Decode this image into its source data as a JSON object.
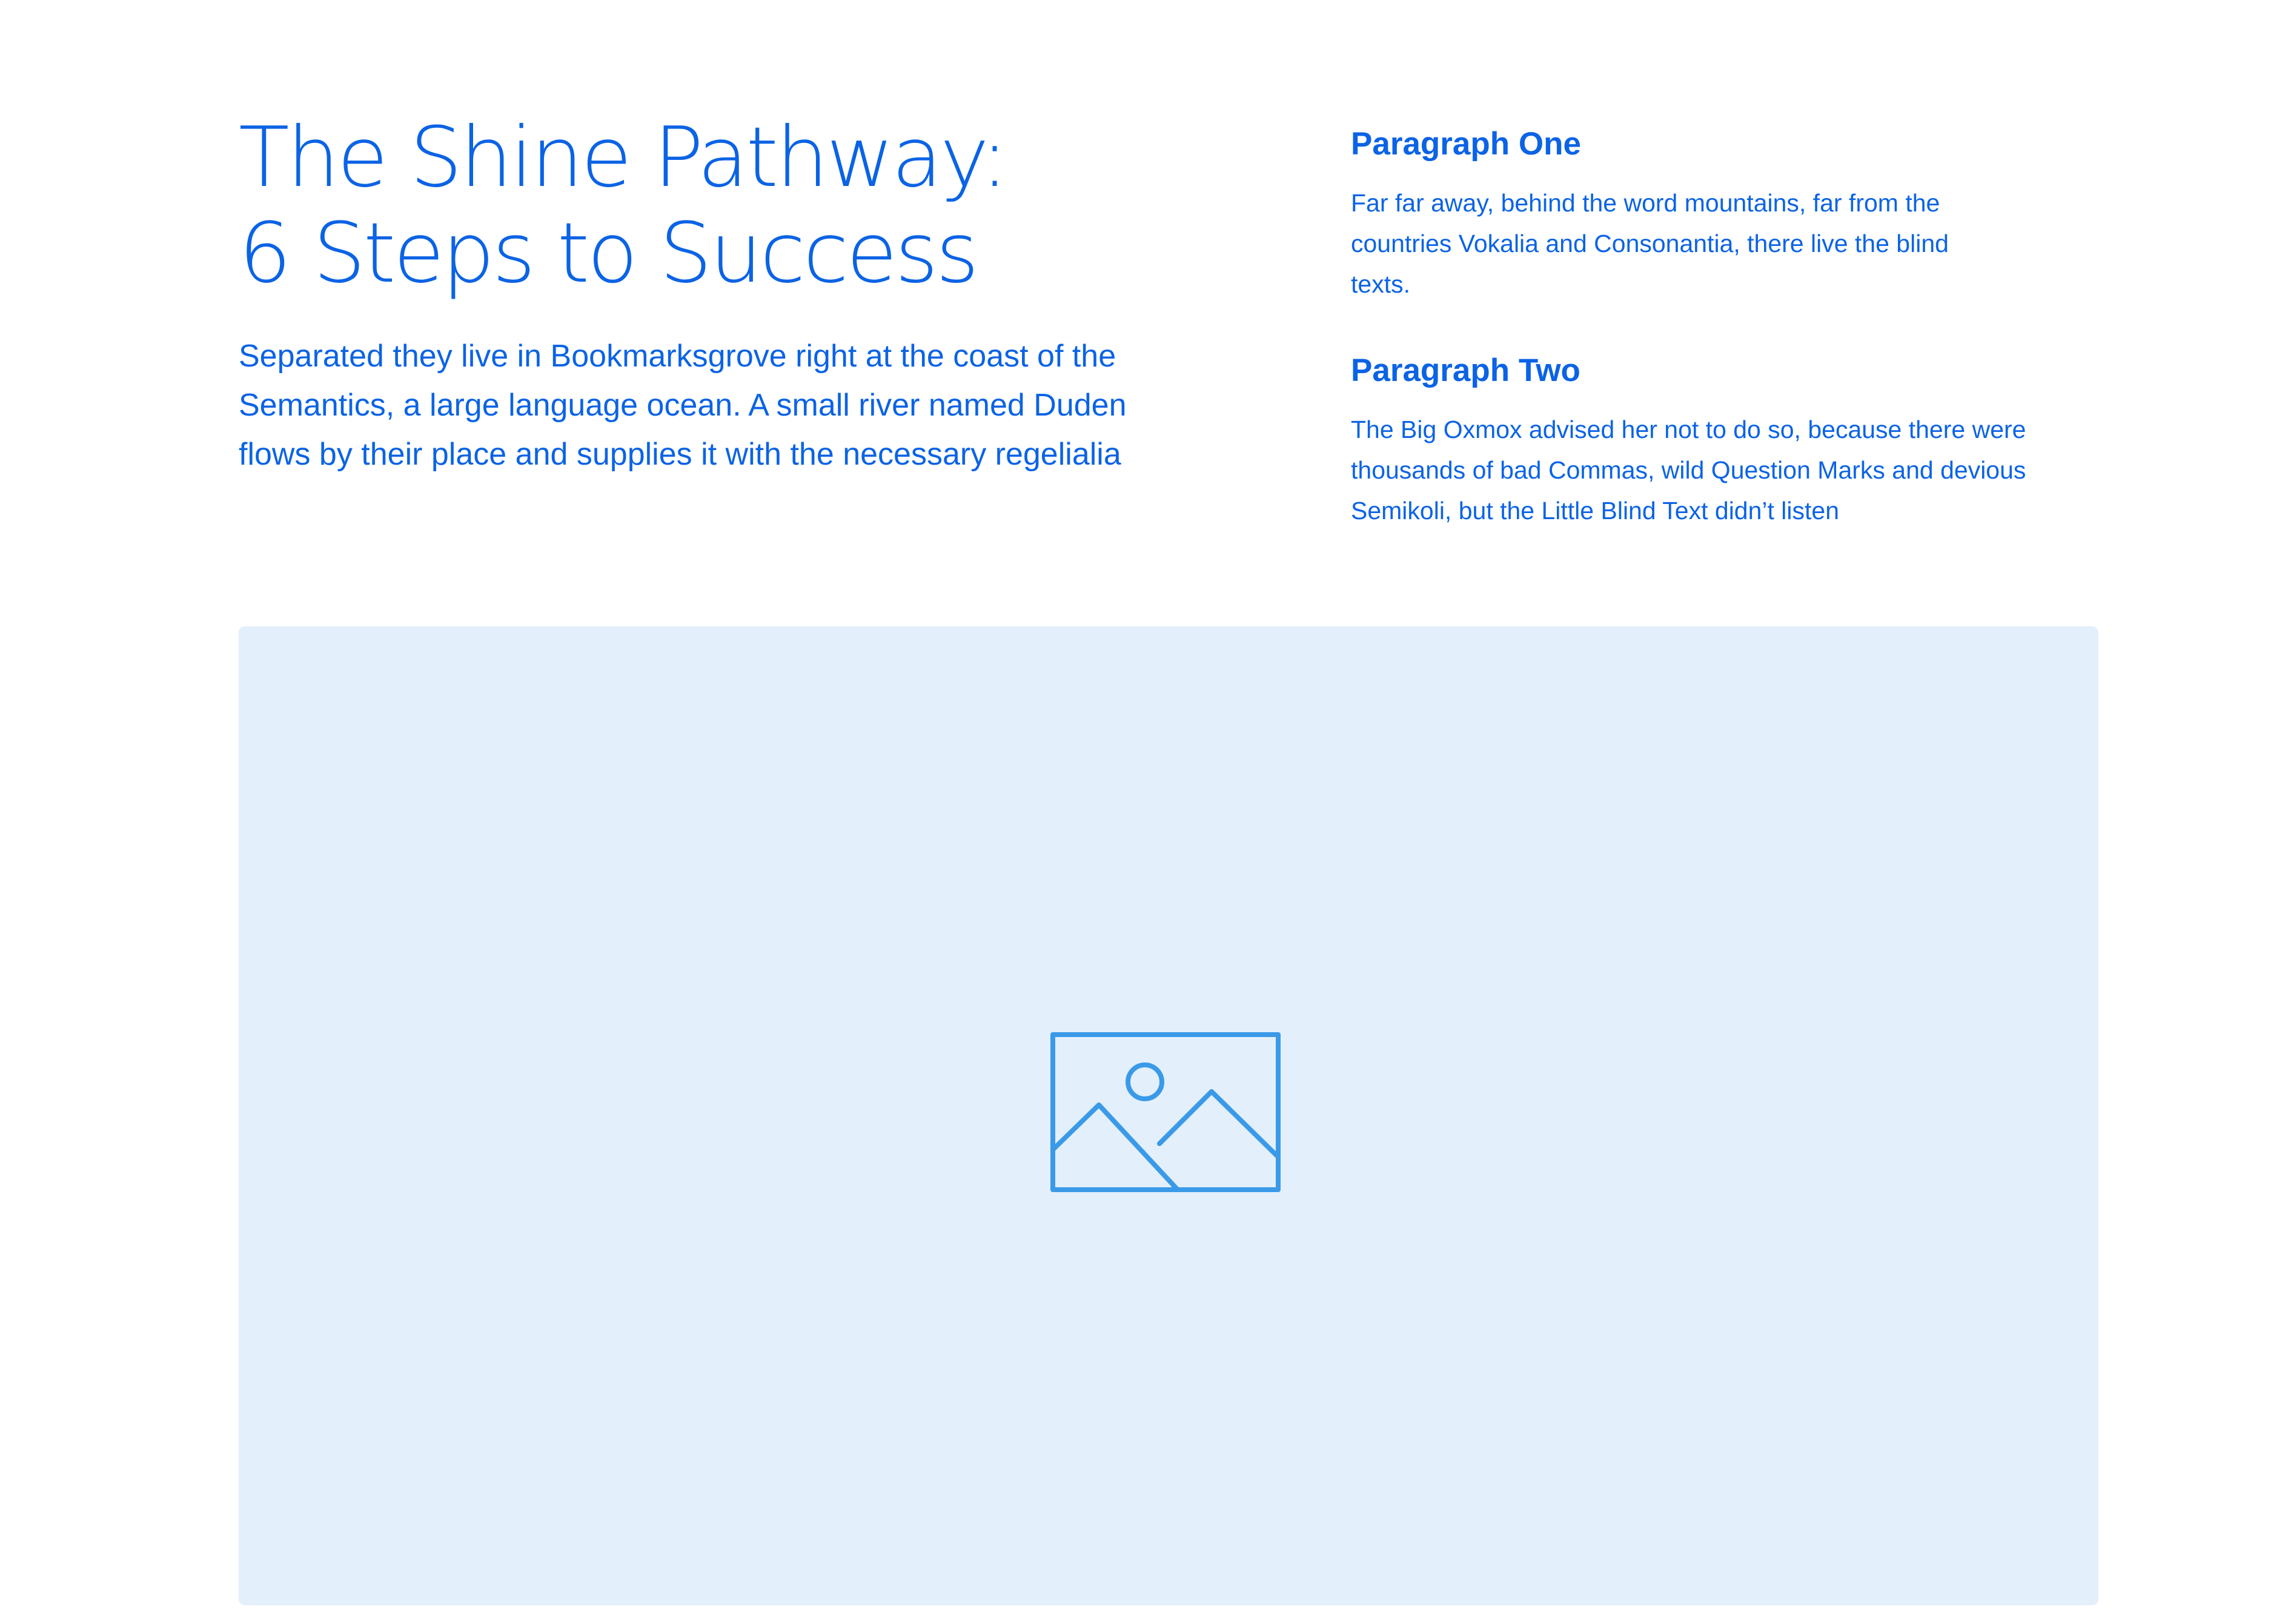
{
  "hero": {
    "title_line1": "The Shine Pathway:",
    "title_line2": "6 Steps to Success",
    "lead": "Separated they live in Bookmarksgrove right at the coast of the Semantics, a large language ocean. A small river named Duden flows by their place and supplies it with the necessary regelialia"
  },
  "sections": [
    {
      "heading": "Paragraph One",
      "body": "Far far away, behind the word mountains, far from the countries Vokalia and Consonantia, there live the blind texts."
    },
    {
      "heading": "Paragraph Two",
      "body": "The Big Oxmox advised her not to do so, because there were thousands of bad Commas, wild Question Marks and devious Semikoli, but the Little Blind Text didn’t listen"
    }
  ],
  "media": {
    "icon": "image-placeholder-icon"
  },
  "colors": {
    "accent": "#0b63e5",
    "placeholder_bg": "#e3effb",
    "icon_stroke": "#3a9ae8"
  }
}
